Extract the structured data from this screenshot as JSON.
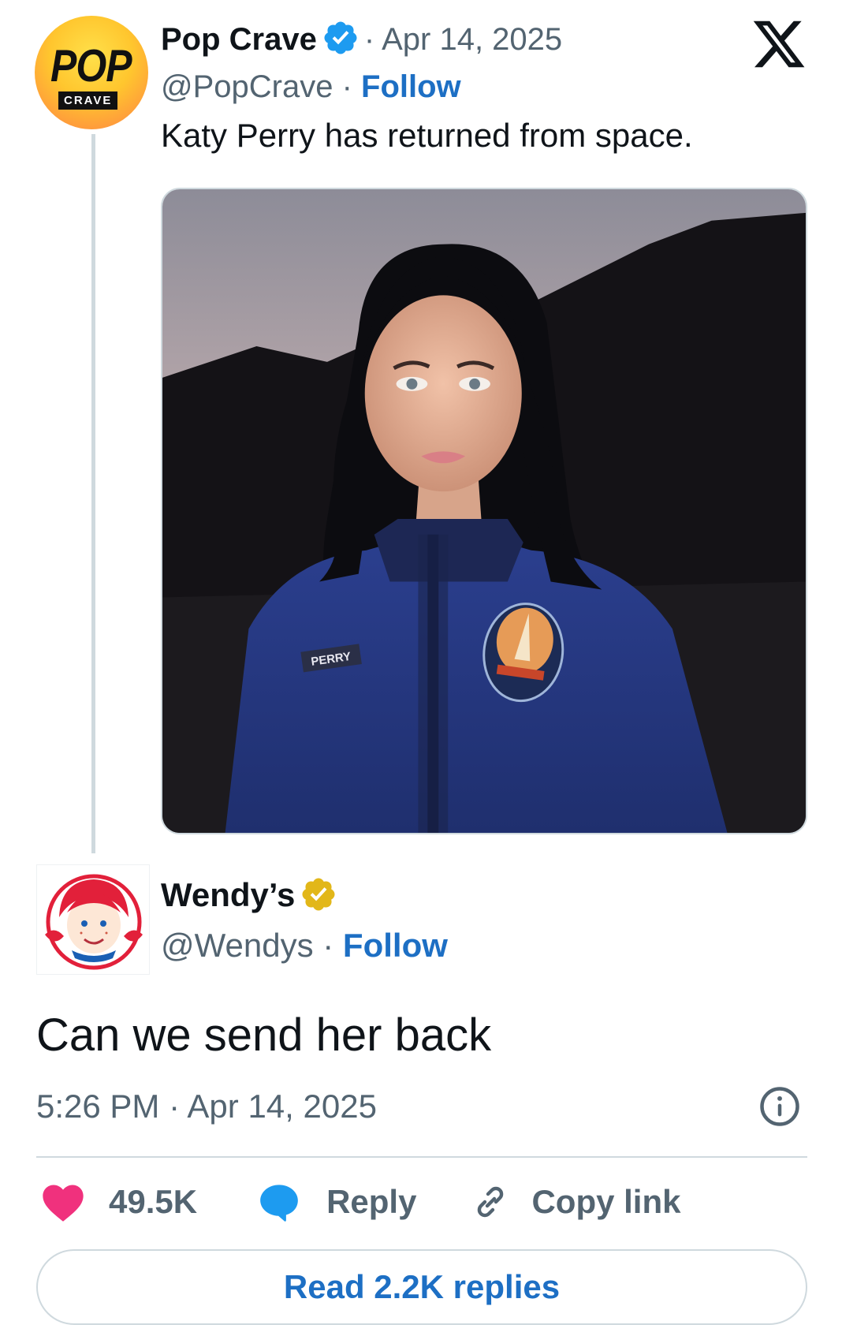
{
  "quoted_tweet": {
    "author_name": "Pop Crave",
    "date": "· Apr 14, 2025",
    "handle": "@PopCrave",
    "separator": " · ",
    "follow_label": "Follow",
    "text": "Katy Perry has returned from space.",
    "avatar_text_top": "POP",
    "avatar_text_bottom": "CRAVE",
    "media_suit_name_tag": "PERRY",
    "verified": "blue"
  },
  "reply_tweet": {
    "author_name": "Wendy’s",
    "handle": "@Wendys",
    "separator": " · ",
    "follow_label": "Follow",
    "text": "Can we send her back",
    "timestamp": "5:26 PM · Apr 14, 2025",
    "verified": "gold"
  },
  "actions": {
    "like_count": "49.5K",
    "reply_label": "Reply",
    "copy_label": "Copy link",
    "read_replies_label": "Read 2.2K replies"
  },
  "icons": {
    "brand_logo": "x-logo-icon",
    "info": "info-icon",
    "like": "heart-icon",
    "reply": "speech-bubble-icon",
    "copy": "link-icon"
  },
  "colors": {
    "link_blue": "#1d6fc4",
    "verified_blue": "#1d9bf0",
    "verified_gold": "#e2b719",
    "heart_pink": "#f0317d",
    "muted_text": "#536471",
    "border": "#cfd9de"
  }
}
